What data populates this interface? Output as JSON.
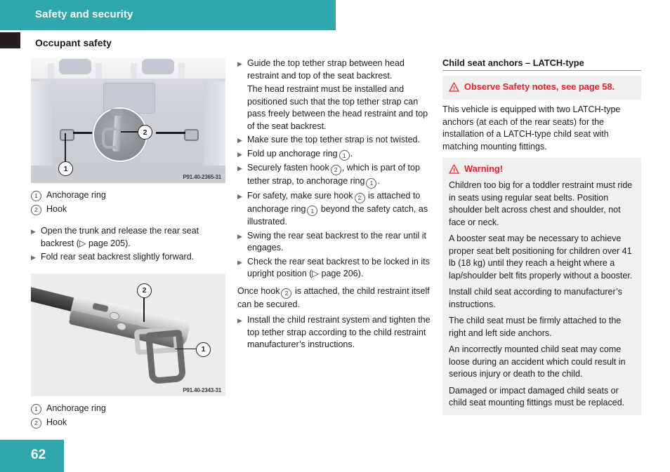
{
  "theme": {
    "teal": "#2ea8ac",
    "warning_red": "#ee1c25",
    "note_bg": "#f0f0f0"
  },
  "header": {
    "title": "Safety and security",
    "section": "Occupant safety"
  },
  "footer": {
    "page_number": "62"
  },
  "left_column": {
    "figure1": {
      "code": "P91.40-2365-31",
      "callout_1": "1",
      "callout_2": "2"
    },
    "legend1": [
      {
        "num": "1",
        "label": "Anchorage ring"
      },
      {
        "num": "2",
        "label": "Hook"
      }
    ],
    "bullets1": [
      "Open the trunk and release the rear seat backrest (▷ page 205).",
      "Fold rear seat backrest slightly forward."
    ],
    "figure2": {
      "code": "P91.40-2343-31",
      "callout_1": "1",
      "callout_2": "2"
    },
    "legend2": [
      {
        "num": "1",
        "label": "Anchorage ring"
      },
      {
        "num": "2",
        "label": "Hook"
      }
    ]
  },
  "middle_column": {
    "bullet_1": "Guide the top tether strap between head restraint and top of the seat backrest.",
    "note_1": "The head restraint must be installed and positioned such that the top tether strap can pass freely between the head restraint and top of the seat backrest.",
    "bullet_2": "Make sure the top tether strap is not twisted.",
    "bullet_3_a": "Fold up anchorage ring",
    "bullet_3_num": "1",
    "bullet_3_b": ".",
    "bullet_4_a": "Securely fasten hook",
    "bullet_4_num1": "2",
    "bullet_4_b": ", which is part of top tether strap, to anchorage ring",
    "bullet_4_num2": "1",
    "bullet_4_c": ".",
    "bullet_5_a": "For safety, make sure hook",
    "bullet_5_num1": "2",
    "bullet_5_b": "is attached to anchorage ring",
    "bullet_5_num2": "1",
    "bullet_5_c": "beyond the safety catch, as illustrated.",
    "bullet_6": "Swing the rear seat backrest to the rear until it engages.",
    "bullet_7": "Check the rear seat backrest to be locked in its upright position (▷ page 206).",
    "para_a": "Once hook",
    "para_num": "2",
    "para_b": "is attached, the child restraint itself can be secured.",
    "bullet_8": "Install the child restraint system and tighten the top tether strap according to the child restraint manufacturer’s instructions."
  },
  "right_column": {
    "heading": "Child seat anchors – LATCH-type",
    "observe_note": {
      "icon": "warning-triangle-icon",
      "text": "Observe Safety notes, see page 58."
    },
    "intro": "This vehicle is equipped with two LATCH-type anchors (at each of the rear seats) for the installation of a LATCH-type child seat with matching mounting fittings.",
    "warning": {
      "icon": "warning-triangle-icon",
      "title": "Warning!",
      "paragraphs": [
        "Children too big for a toddler restraint must ride in seats using regular seat belts. Position shoulder belt across chest and shoulder, not face or neck.",
        "A booster seat may be necessary to achieve proper seat belt positioning for children over 41 lb (18 kg) until they reach a height where a lap/shoulder belt fits properly without a booster.",
        "Install child seat according to manufacturer’s instructions.",
        "The child seat must be firmly attached to the right and left side anchors.",
        "An incorrectly mounted child seat may come loose during an accident which could result in serious injury or death to the child.",
        "Damaged or impact damaged child seats or child seat mounting fittings must be replaced."
      ]
    }
  }
}
